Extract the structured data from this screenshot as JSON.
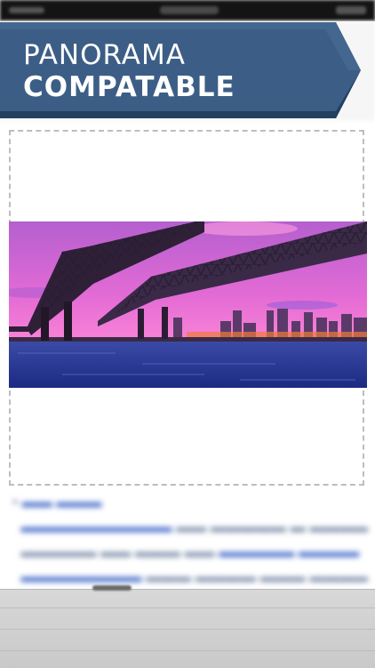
{
  "banner": {
    "line1": "PANORAMA",
    "line2": "COMPATABLE"
  },
  "colors": {
    "banner_blue": "#3c5e86",
    "banner_blue_dark": "#22405f",
    "frame_dash": "#bdbdbd"
  },
  "image": {
    "subject": "bridge-panorama-photo"
  }
}
